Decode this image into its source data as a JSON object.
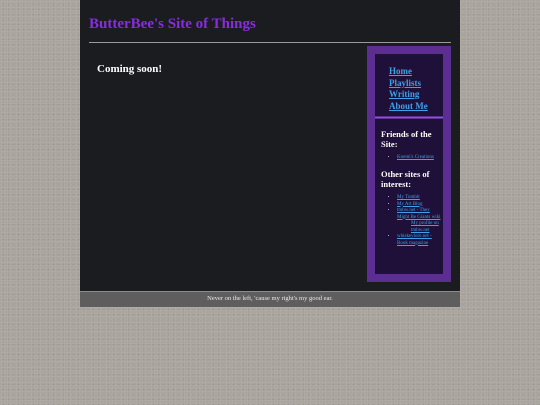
{
  "header": {
    "title": "ButterBee's Site of Things"
  },
  "main": {
    "heading": "Coming soon!"
  },
  "sidebar": {
    "nav": [
      {
        "label": "Home"
      },
      {
        "label": "Playlists"
      },
      {
        "label": "Writing"
      },
      {
        "label": "About Me"
      }
    ],
    "friends_heading": "Friends of the Site:",
    "friends": [
      {
        "label": "Koemi's Creations"
      }
    ],
    "other_heading": "Other sites of interest:",
    "other": [
      {
        "label": "My Tumblr"
      },
      {
        "label": "My Art Blog"
      },
      {
        "label": "tmbw.net - They Might Be Giants wiki",
        "sub": "My profile on tmbw.net"
      },
      {
        "label": "whiskeylore.net - Book magazine"
      }
    ]
  },
  "footer": {
    "text": "Never on the left, 'cause my right's my good ear."
  },
  "colors": {
    "background": "#a9a49e",
    "panel": "#1b1c20",
    "title": "#8a2be2",
    "sidebar_frame": "#5c2e91",
    "sidebar_inner": "#1e1038",
    "link": "#3fa0e8",
    "footer_bg": "#5e5e5e"
  }
}
